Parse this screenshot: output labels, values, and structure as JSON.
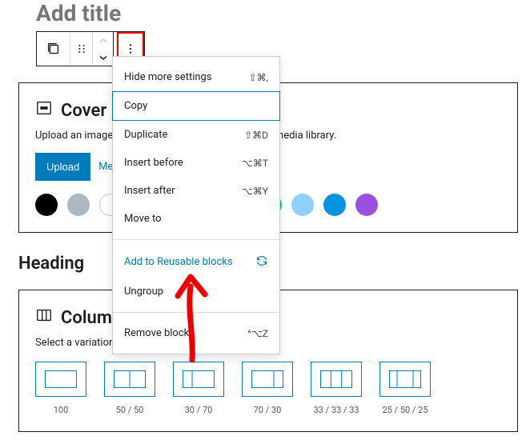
{
  "title": "Add title",
  "toolbar": {
    "move_up": "▲",
    "move_down": "▼"
  },
  "cover": {
    "title": "Cover",
    "desc": "Upload an image or video file, or pick one from your media library.",
    "upload_label": "Upload",
    "media_library_label": "Media Library",
    "colors": [
      "#000000",
      "#abb8c2",
      "#ffffff",
      "#f78da7",
      "#cf2e2e",
      "#ff6900",
      "#fcb900",
      "#00d084",
      "#8ed1fc",
      "#0693e3",
      "#9b51e0"
    ]
  },
  "heading_label": "Heading",
  "columns": {
    "title": "Columns",
    "desc": "Select a variation to start with.",
    "variations": [
      {
        "label": "100",
        "cols": [
          1
        ]
      },
      {
        "label": "50 / 50",
        "cols": [
          1,
          1
        ]
      },
      {
        "label": "30 / 70",
        "cols": [
          0.43,
          1
        ]
      },
      {
        "label": "70 / 30",
        "cols": [
          1,
          0.43
        ]
      },
      {
        "label": "33 / 33 / 33",
        "cols": [
          1,
          1,
          1
        ]
      },
      {
        "label": "25 / 50 / 25",
        "cols": [
          0.5,
          1,
          0.5
        ]
      }
    ]
  },
  "menu": {
    "groups": [
      [
        {
          "label": "Hide more settings",
          "shortcut": "⇧⌘,",
          "selected": false
        },
        {
          "label": "Copy",
          "shortcut": "",
          "selected": true
        },
        {
          "label": "Duplicate",
          "shortcut": "⇧⌘D",
          "selected": false
        },
        {
          "label": "Insert before",
          "shortcut": "⌥⌘T",
          "selected": false
        },
        {
          "label": "Insert after",
          "shortcut": "⌥⌘Y",
          "selected": false
        },
        {
          "label": "Move to",
          "shortcut": "",
          "selected": false
        }
      ],
      [
        {
          "label": "Add to Reusable blocks",
          "shortcut": "",
          "selected": false,
          "blue": true,
          "icon": "rotate"
        },
        {
          "label": "Ungroup",
          "shortcut": "",
          "selected": false
        }
      ],
      [
        {
          "label": "Remove block",
          "shortcut": "^⌥Z",
          "selected": false
        }
      ]
    ]
  }
}
